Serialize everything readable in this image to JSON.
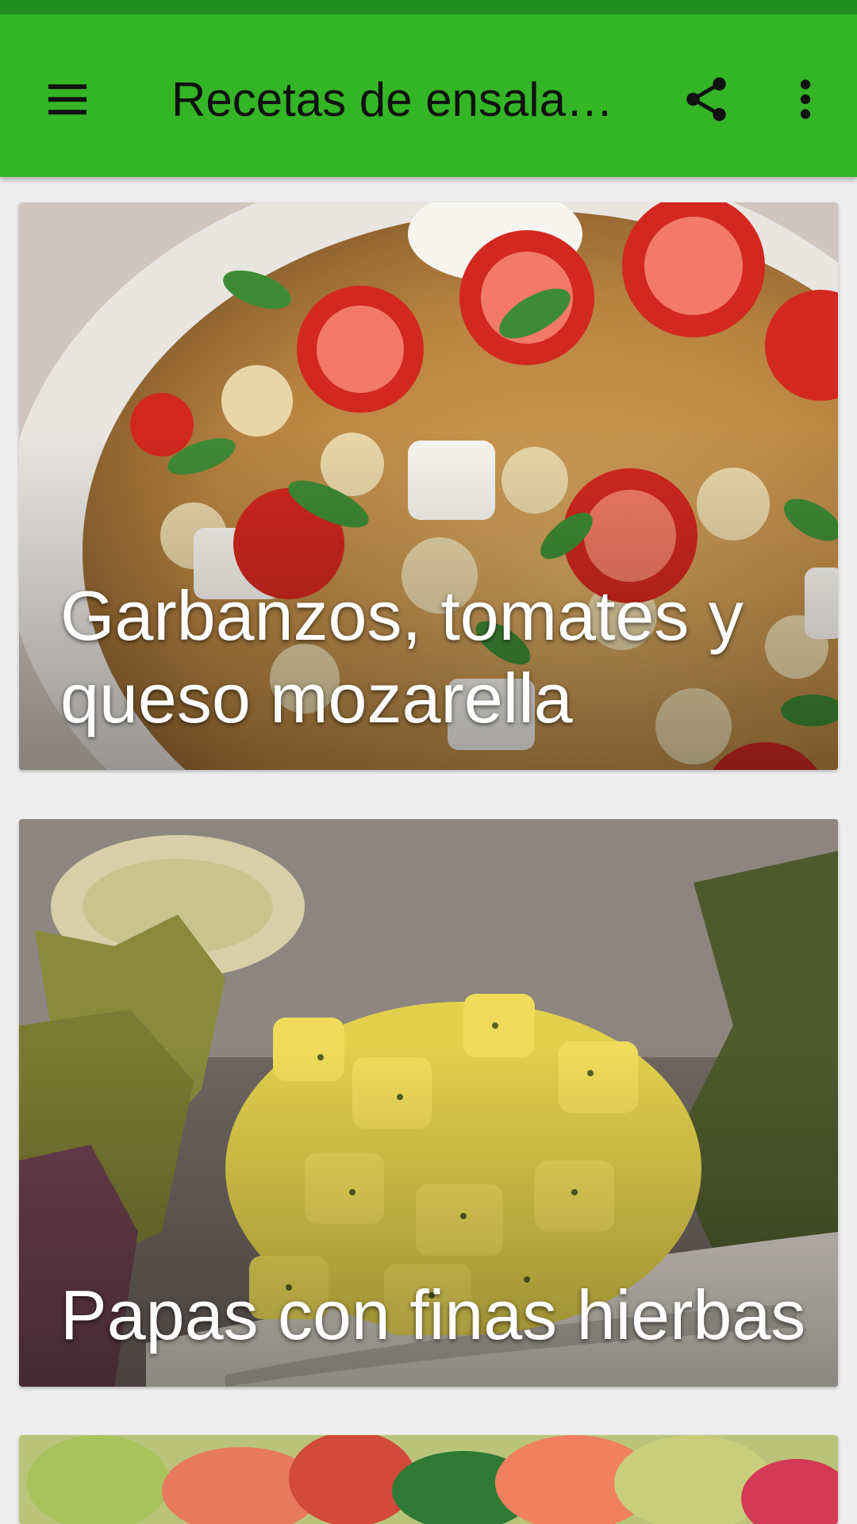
{
  "app_bar": {
    "title": "Recetas de ensaladas",
    "menu_icon": "menu-icon",
    "share_icon": "share-icon",
    "more_icon": "more-vert-icon",
    "background_color": "#33b526",
    "status_bar_color": "#1f8f1d"
  },
  "recipes": [
    {
      "title": "Garbanzos, tomates y queso mozarella"
    },
    {
      "title": "Papas con finas hierbas"
    },
    {
      "title": ""
    }
  ]
}
